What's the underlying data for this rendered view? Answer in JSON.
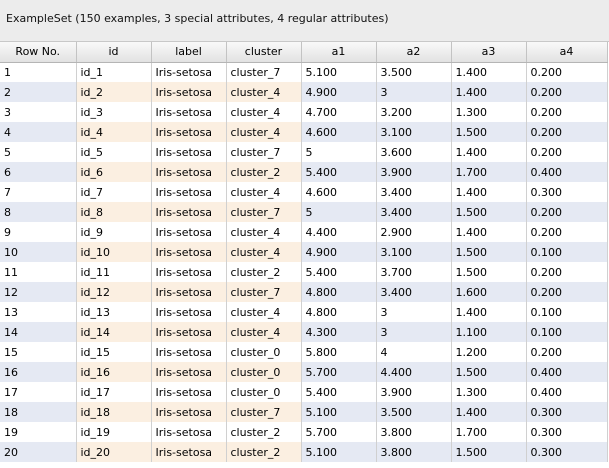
{
  "header": {
    "title": "ExampleSet (150 examples, 3 special attributes, 4 regular attributes)"
  },
  "table": {
    "columns": [
      "Row No.",
      "id",
      "label",
      "cluster",
      "a1",
      "a2",
      "a3",
      "a4"
    ],
    "rows": [
      [
        "1",
        "id_1",
        "Iris-setosa",
        "cluster_7",
        "5.100",
        "3.500",
        "1.400",
        "0.200"
      ],
      [
        "2",
        "id_2",
        "Iris-setosa",
        "cluster_4",
        "4.900",
        "3",
        "1.400",
        "0.200"
      ],
      [
        "3",
        "id_3",
        "Iris-setosa",
        "cluster_4",
        "4.700",
        "3.200",
        "1.300",
        "0.200"
      ],
      [
        "4",
        "id_4",
        "Iris-setosa",
        "cluster_4",
        "4.600",
        "3.100",
        "1.500",
        "0.200"
      ],
      [
        "5",
        "id_5",
        "Iris-setosa",
        "cluster_7",
        "5",
        "3.600",
        "1.400",
        "0.200"
      ],
      [
        "6",
        "id_6",
        "Iris-setosa",
        "cluster_2",
        "5.400",
        "3.900",
        "1.700",
        "0.400"
      ],
      [
        "7",
        "id_7",
        "Iris-setosa",
        "cluster_4",
        "4.600",
        "3.400",
        "1.400",
        "0.300"
      ],
      [
        "8",
        "id_8",
        "Iris-setosa",
        "cluster_7",
        "5",
        "3.400",
        "1.500",
        "0.200"
      ],
      [
        "9",
        "id_9",
        "Iris-setosa",
        "cluster_4",
        "4.400",
        "2.900",
        "1.400",
        "0.200"
      ],
      [
        "10",
        "id_10",
        "Iris-setosa",
        "cluster_4",
        "4.900",
        "3.100",
        "1.500",
        "0.100"
      ],
      [
        "11",
        "id_11",
        "Iris-setosa",
        "cluster_2",
        "5.400",
        "3.700",
        "1.500",
        "0.200"
      ],
      [
        "12",
        "id_12",
        "Iris-setosa",
        "cluster_7",
        "4.800",
        "3.400",
        "1.600",
        "0.200"
      ],
      [
        "13",
        "id_13",
        "Iris-setosa",
        "cluster_4",
        "4.800",
        "3",
        "1.400",
        "0.100"
      ],
      [
        "14",
        "id_14",
        "Iris-setosa",
        "cluster_4",
        "4.300",
        "3",
        "1.100",
        "0.100"
      ],
      [
        "15",
        "id_15",
        "Iris-setosa",
        "cluster_0",
        "5.800",
        "4",
        "1.200",
        "0.200"
      ],
      [
        "16",
        "id_16",
        "Iris-setosa",
        "cluster_0",
        "5.700",
        "4.400",
        "1.500",
        "0.400"
      ],
      [
        "17",
        "id_17",
        "Iris-setosa",
        "cluster_0",
        "5.400",
        "3.900",
        "1.300",
        "0.400"
      ],
      [
        "18",
        "id_18",
        "Iris-setosa",
        "cluster_7",
        "5.100",
        "3.500",
        "1.400",
        "0.300"
      ],
      [
        "19",
        "id_19",
        "Iris-setosa",
        "cluster_2",
        "5.700",
        "3.800",
        "1.700",
        "0.300"
      ],
      [
        "20",
        "id_20",
        "Iris-setosa",
        "cluster_2",
        "5.100",
        "3.800",
        "1.500",
        "0.300"
      ]
    ]
  },
  "colors": {
    "special_column_bg": "#fbefe1",
    "even_row_bg": "#e5e9f3",
    "odd_row_bg": "#ffffff",
    "header_bg": "#e2e2e2"
  }
}
